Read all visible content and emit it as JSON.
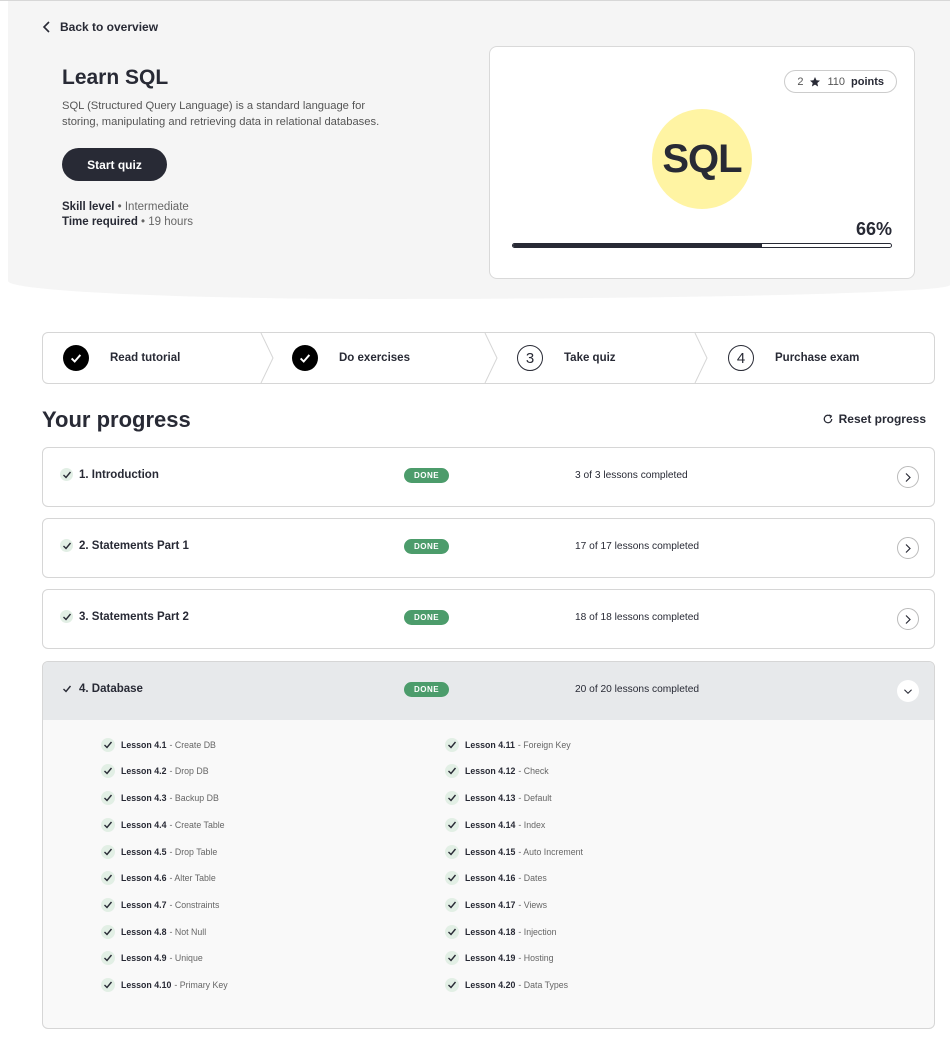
{
  "nav": {
    "back_label": "Back to overview"
  },
  "course": {
    "title": "Learn SQL",
    "description": "SQL (Structured Query Language) is a standard language for storing, manipulating and retrieving data in relational databases.",
    "start_button": "Start quiz",
    "skill_label": "Skill level",
    "skill_value": "Intermediate",
    "time_label": "Time required",
    "time_value": "19 hours"
  },
  "card": {
    "stars": "2",
    "points_value": "110",
    "points_label": "points",
    "logo_text": "SQL",
    "progress_label": "66%",
    "progress": 0.66
  },
  "steps": [
    {
      "label": "Read tutorial",
      "status": "done"
    },
    {
      "label": "Do exercises",
      "status": "done"
    },
    {
      "label": "Take quiz",
      "status": "number",
      "number": "3"
    },
    {
      "label": "Purchase exam",
      "status": "number",
      "number": "4"
    }
  ],
  "progress": {
    "title": "Your progress",
    "reset_label": "Reset progress"
  },
  "chapters": [
    {
      "name": "1. Introduction",
      "badge": "DONE",
      "count": "3 of 3 lessons completed"
    },
    {
      "name": "2. Statements Part 1",
      "badge": "DONE",
      "count": "17 of 17 lessons completed"
    },
    {
      "name": "3. Statements Part 2",
      "badge": "DONE",
      "count": "18 of 18 lessons completed"
    },
    {
      "name": "4. Database",
      "badge": "DONE",
      "count": "20 of 20 lessons completed"
    }
  ],
  "lessons": [
    {
      "num": "Lesson 4.1",
      "title": " - Create DB"
    },
    {
      "num": "Lesson 4.2",
      "title": " - Drop DB"
    },
    {
      "num": "Lesson 4.3",
      "title": " - Backup DB"
    },
    {
      "num": "Lesson 4.4",
      "title": " - Create Table"
    },
    {
      "num": "Lesson 4.5",
      "title": " - Drop Table"
    },
    {
      "num": "Lesson 4.6",
      "title": " - Alter Table"
    },
    {
      "num": "Lesson 4.7",
      "title": " - Constraints"
    },
    {
      "num": "Lesson 4.8",
      "title": " - Not Null"
    },
    {
      "num": "Lesson 4.9",
      "title": " - Unique"
    },
    {
      "num": "Lesson 4.10",
      "title": " - Primary Key"
    },
    {
      "num": "Lesson 4.11",
      "title": " - Foreign Key"
    },
    {
      "num": "Lesson 4.12",
      "title": " - Check"
    },
    {
      "num": "Lesson 4.13",
      "title": " - Default"
    },
    {
      "num": "Lesson 4.14",
      "title": " - Index"
    },
    {
      "num": "Lesson 4.15",
      "title": " - Auto Increment"
    },
    {
      "num": "Lesson 4.16",
      "title": " - Dates"
    },
    {
      "num": "Lesson 4.17",
      "title": " - Views"
    },
    {
      "num": "Lesson 4.18",
      "title": " - Injection"
    },
    {
      "num": "Lesson 4.19",
      "title": " - Hosting"
    },
    {
      "num": "Lesson 4.20",
      "title": " - Data Types"
    }
  ],
  "colors": {
    "dark": "#282a35",
    "done_green": "#4c9c6b",
    "sql_yellow": "#fff4a3"
  }
}
